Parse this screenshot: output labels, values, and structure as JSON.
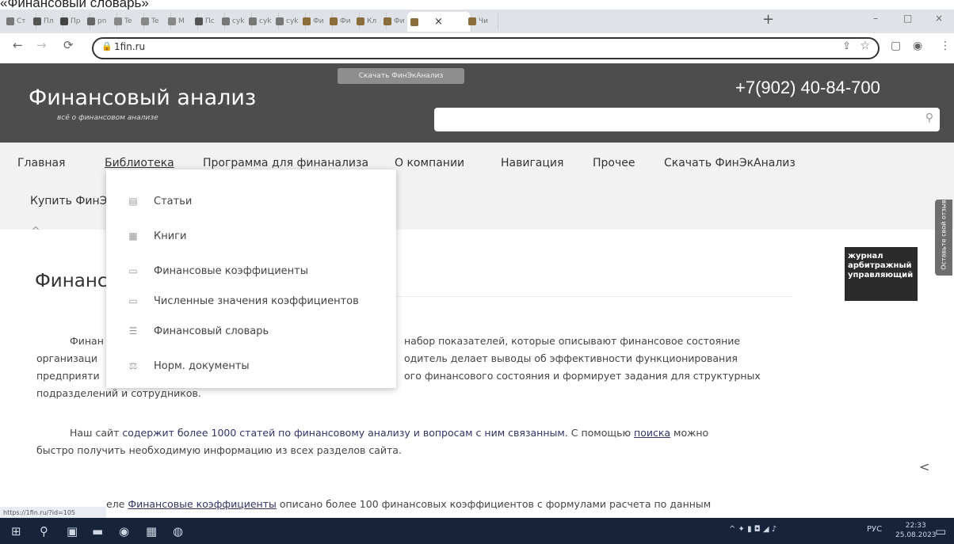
{
  "caption": "«Финансовый словарь»",
  "browser": {
    "tabs": [
      {
        "label": "Ст",
        "color": "#777"
      },
      {
        "label": "Пл",
        "color": "#555"
      },
      {
        "label": "Пр",
        "color": "#444"
      },
      {
        "label": "pn",
        "color": "#666"
      },
      {
        "label": "Te",
        "color": "#888"
      },
      {
        "label": "Te",
        "color": "#888"
      },
      {
        "label": "M",
        "color": "#888"
      },
      {
        "label": "Пс",
        "color": "#555"
      },
      {
        "label": "cyk",
        "color": "#777"
      },
      {
        "label": "cyk",
        "color": "#777"
      },
      {
        "label": "cyk",
        "color": "#777"
      },
      {
        "label": "Фи",
        "color": "#8a6d3b"
      },
      {
        "label": "Фи",
        "color": "#8a6d3b"
      },
      {
        "label": "Кл",
        "color": "#8a6d3b"
      },
      {
        "label": "Фи",
        "color": "#8a6d3b"
      },
      {
        "label": "",
        "color": "#8a6d3b",
        "active": true
      },
      {
        "label": "Чи",
        "color": "#8a6d3b"
      }
    ],
    "new_tab": "+",
    "close_tab": "×",
    "url": "1fin.ru",
    "window_controls": [
      "–",
      "□",
      "×"
    ]
  },
  "header": {
    "title": "Финансовый анализ",
    "subtitle": "всё о финансовом анализе",
    "download_button": "Скачать ФинЭкАнализ",
    "phone": "+7(902) 40-84-700",
    "search_placeholder": ""
  },
  "nav": {
    "items": [
      "Главная",
      "Библиотека",
      "Программа для финанализа",
      "О компании",
      "Навигация",
      "Прочее",
      "Скачать ФинЭкАнализ"
    ],
    "row2": "Купить ФинЭ"
  },
  "dropdown": {
    "items": [
      {
        "label": "Статьи",
        "icon": "article-icon"
      },
      {
        "label": "Книги",
        "icon": "books-icon"
      },
      {
        "label": "Финансовые коэффициенты",
        "icon": "coefficients-icon"
      },
      {
        "label": "Численные значения коэффициентов",
        "icon": "values-icon"
      },
      {
        "label": "Финансовый словарь",
        "icon": "dictionary-icon"
      },
      {
        "label": "Норм. документы",
        "icon": "scales-icon"
      }
    ]
  },
  "content": {
    "title": "Финансовый анализ",
    "p1_start": "Финан",
    "p1_line1": "набор показателей, которые описывают финансовое состояние",
    "p1_line2a": "организаци",
    "p1_line2b": "одитель делает выводы об эффективности функционирования",
    "p1_line3a": "предприяти",
    "p1_line3b": "ого финансового состояния и формирует задания для структурных",
    "p1_line4": "подразделений и сотрудников.",
    "p2_a": "Наш сайт ",
    "p2_link1": "содержит более 1000 статей по финансовому анализу и вопросам с ним связанным.",
    "p2_b": " С помощью ",
    "p2_link2": "поиска",
    "p2_c": " можно",
    "p2_line2": "быстро получить необходимую информацию из всех разделов сайта.",
    "p3_a": "еле ",
    "p3_link": "Финансовые коэффициенты",
    "p3_b": " описано более 100 финансовых коэффициентов с формулами расчета по данным",
    "banner": "журнал арбитражный управляющий",
    "feedback": "Оставьте свой отзыв"
  },
  "status_url": "https://1fin.ru/?id=105",
  "taskbar": {
    "lang": "РУС",
    "time": "22:33",
    "date": "25.08.2023"
  }
}
